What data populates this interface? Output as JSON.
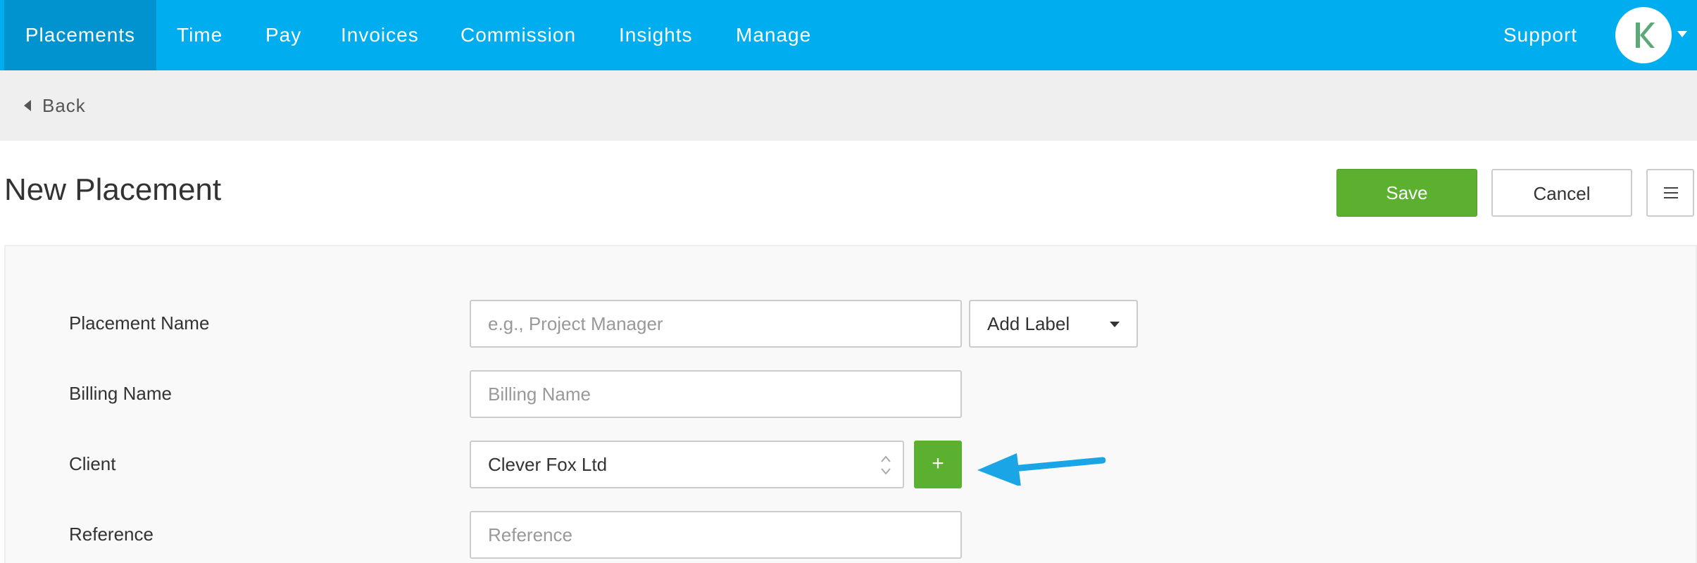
{
  "nav": {
    "items": [
      {
        "label": "Placements",
        "active": true
      },
      {
        "label": "Time"
      },
      {
        "label": "Pay"
      },
      {
        "label": "Invoices"
      },
      {
        "label": "Commission"
      },
      {
        "label": "Insights"
      },
      {
        "label": "Manage"
      }
    ],
    "support_label": "Support",
    "avatar_icon": "k-logo-icon"
  },
  "subbar": {
    "back_label": "Back"
  },
  "page": {
    "title": "New Placement",
    "save_label": "Save",
    "cancel_label": "Cancel",
    "menu_icon": "hamburger-icon"
  },
  "form": {
    "placement_name": {
      "label": "Placement Name",
      "placeholder": "e.g., Project Manager",
      "value": ""
    },
    "add_label": {
      "label": "Add Label"
    },
    "billing_name": {
      "label": "Billing Name",
      "placeholder": "Billing Name",
      "value": ""
    },
    "client": {
      "label": "Client",
      "value": "Clever Fox Ltd",
      "add_button": "+"
    },
    "reference": {
      "label": "Reference",
      "placeholder": "Reference",
      "value": ""
    }
  },
  "colors": {
    "nav_bg": "#00adef",
    "nav_active_bg": "#0093cf",
    "primary_green": "#5cb030",
    "arrow_blue": "#1aa5e6",
    "logo_green": "#5aaa78"
  }
}
